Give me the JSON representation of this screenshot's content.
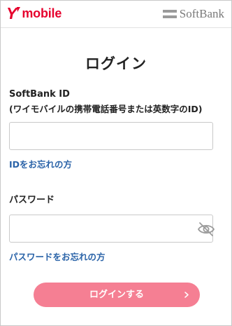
{
  "header": {
    "brand_y": "Y",
    "brand_name": "mobile",
    "partner_name": "SoftBank",
    "brand_color": "#e6002d",
    "partner_logo_icon": "softbank-bars-icon"
  },
  "page": {
    "title": "ログイン"
  },
  "form": {
    "id_label": "SoftBank ID",
    "id_sublabel": "(ワイモバイルの携帯電話番号または英数字のID)",
    "id_value": "",
    "forgot_id_link": "IDをお忘れの方",
    "password_label": "パスワード",
    "password_value": "",
    "password_toggle_icon": "eye-slash-icon",
    "forgot_password_link": "パスワードをお忘れの方",
    "submit_label": "ログインする",
    "submit_icon": "chevron-right-icon",
    "link_color": "#2a63a8",
    "button_color": "#f57f93"
  }
}
